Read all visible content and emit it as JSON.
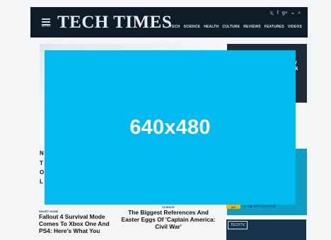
{
  "header": {
    "logo": "TECH TIMES",
    "menu_label": "MENU",
    "nav": [
      "TECH",
      "SCIENCE",
      "HEALTH",
      "CULTURE",
      "REVIEWS",
      "FEATURES",
      "VIDEOS"
    ],
    "social_icons": [
      "twitter-icon",
      "facebook-icon",
      "google-plus-icon",
      "rss-icon",
      "search-icon"
    ],
    "social_glyphs": [
      "𝕏",
      "f",
      "g+",
      "⌁",
      "⌕"
    ]
  },
  "ad": {
    "label": "640x480",
    "color": "#00baf0"
  },
  "articles": [
    {
      "kicker": "SMART HOME",
      "title": "Fallout 4 Survival Mode Comes To Xbox One And PS4: Here's What You"
    },
    {
      "kicker": "SCIENCE",
      "title": "The Biggest References And Easter Eggs Of 'Captain America: Civil War'"
    }
  ],
  "left_glyphs": [
    "N",
    "T",
    "O",
    "L"
  ],
  "side_card_glyphs": [
    "r",
    "k"
  ],
  "side_promo": {
    "badge": "TECHTV",
    "button": "ghk",
    "text": "or call 844-214-6729"
  }
}
